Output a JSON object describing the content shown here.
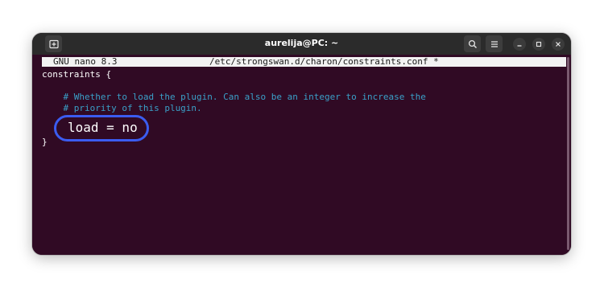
{
  "window": {
    "title": "aurelija@PC: ~",
    "accent": "#3b5cf0",
    "background": "#300a24"
  },
  "titlebar": {
    "new_tab_icon": "new-tab-icon",
    "search_icon": "search-icon",
    "menu_icon": "hamburger-menu-icon",
    "minimize_icon": "minimize-icon",
    "maximize_icon": "maximize-icon",
    "close_icon": "close-icon"
  },
  "nano": {
    "version": "GNU nano 8.3",
    "filename": "/etc/strongswan.d/charon/constraints.conf *"
  },
  "file": {
    "line1": "constraints {",
    "comment1": "    # Whether to load the plugin. Can also be an integer to increase the",
    "comment2": "    # priority of this plugin.",
    "setting": "load = no",
    "close": "}"
  }
}
